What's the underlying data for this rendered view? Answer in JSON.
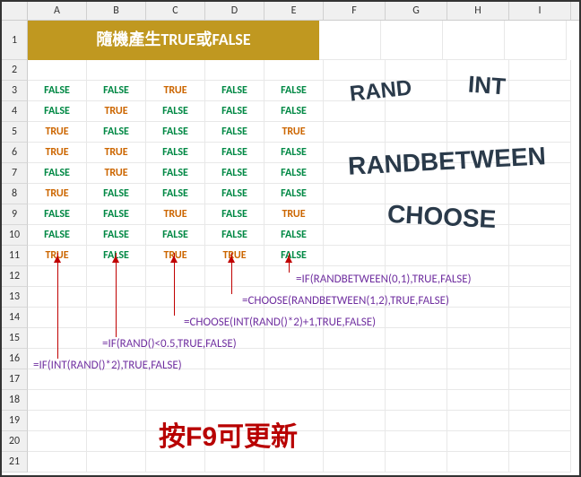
{
  "cols": [
    "A",
    "B",
    "C",
    "D",
    "E",
    "F",
    "G",
    "H",
    "I"
  ],
  "rows": [
    "1",
    "2",
    "3",
    "4",
    "5",
    "6",
    "7",
    "8",
    "9",
    "10",
    "11",
    "12",
    "13",
    "14",
    "15",
    "16",
    "17",
    "18",
    "19",
    "20",
    "21"
  ],
  "title": "隨機產生TRUE或FALSE",
  "tf": [
    [
      "FALSE",
      "FALSE",
      "TRUE",
      "FALSE",
      "FALSE"
    ],
    [
      "FALSE",
      "TRUE",
      "FALSE",
      "FALSE",
      "FALSE"
    ],
    [
      "TRUE",
      "FALSE",
      "FALSE",
      "FALSE",
      "TRUE"
    ],
    [
      "TRUE",
      "TRUE",
      "FALSE",
      "FALSE",
      "FALSE"
    ],
    [
      "FALSE",
      "TRUE",
      "FALSE",
      "FALSE",
      "FALSE"
    ],
    [
      "TRUE",
      "FALSE",
      "FALSE",
      "FALSE",
      "FALSE"
    ],
    [
      "FALSE",
      "FALSE",
      "TRUE",
      "FALSE",
      "TRUE"
    ],
    [
      "FALSE",
      "FALSE",
      "FALSE",
      "FALSE",
      "FALSE"
    ],
    [
      "TRUE",
      "FALSE",
      "TRUE",
      "TRUE",
      "FALSE"
    ]
  ],
  "decor": {
    "rand": "RAND",
    "int": "INT",
    "rb": "RANDBETWEEN",
    "choose": "CHOOSE"
  },
  "formulas": {
    "f1": "=IF(RANDBETWEEN(0,1),TRUE,FALSE)",
    "f2": "=CHOOSE(RANDBETWEEN(1,2),TRUE,FALSE)",
    "f3": "=CHOOSE(INT(RAND()*2)+1,TRUE,FALSE)",
    "f4": "=IF(RAND()<0.5,TRUE,FALSE)",
    "f5": "=IF(INT(RAND()*2),TRUE,FALSE)"
  },
  "hint": "按F9可更新"
}
